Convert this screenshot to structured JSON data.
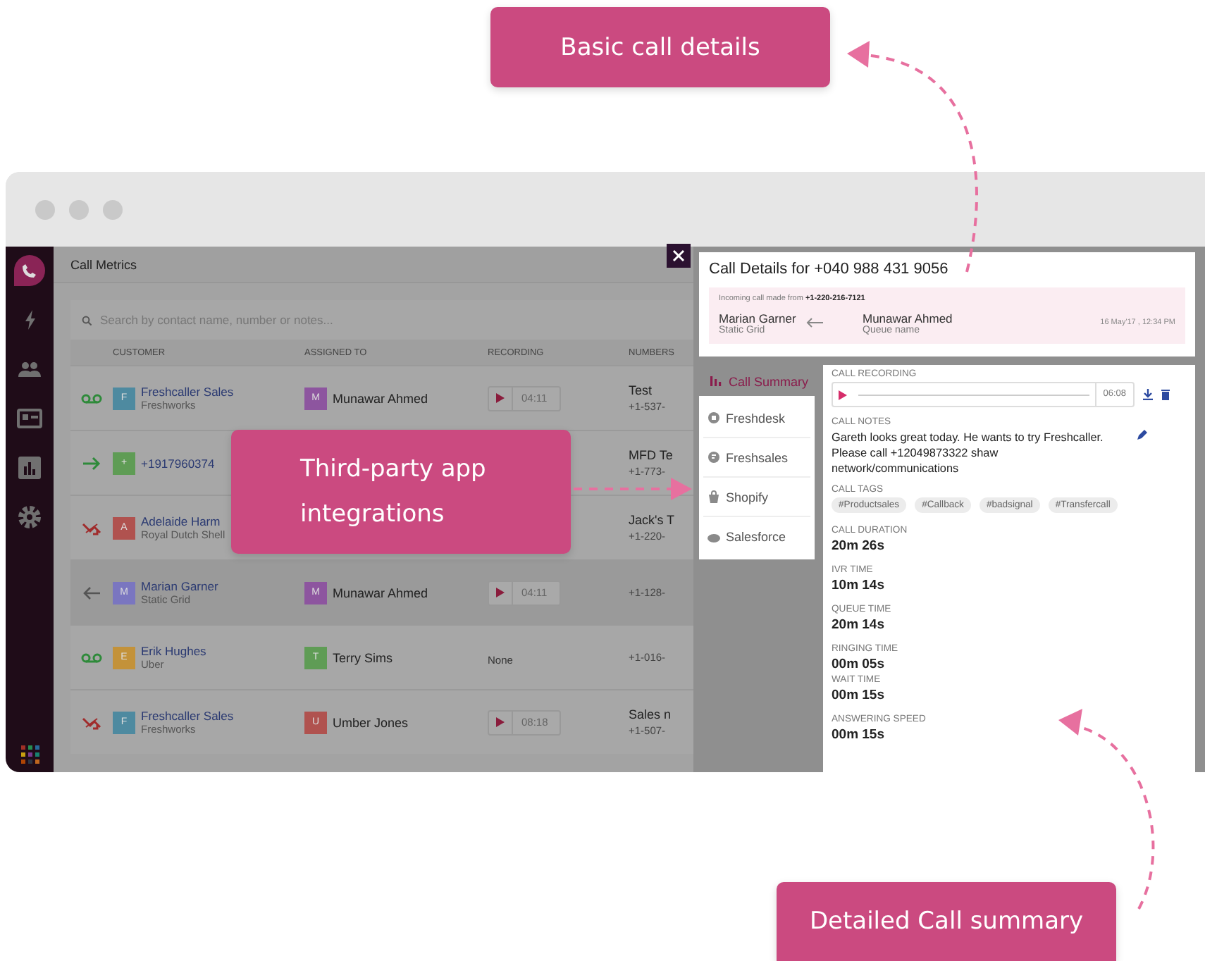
{
  "callouts": [
    {
      "text": "Basic call details"
    },
    {
      "text": "Third-party app integrations"
    },
    {
      "text": "Detailed Call summary"
    }
  ],
  "sidebar": {
    "items": [
      {
        "selected": true
      },
      {
        "selected": false
      },
      {
        "selected": false
      },
      {
        "selected": false
      },
      {
        "selected": false
      },
      {
        "selected": false
      }
    ]
  },
  "page_title": "Call Metrics",
  "search": {
    "placeholder": "Search by contact name, number or notes..."
  },
  "table": {
    "columns": [
      "CUSTOMER",
      "ASSIGNED TO",
      "RECORDING",
      "NUMBERS"
    ],
    "rows": [
      {
        "kind": "voicemail",
        "avatar": "F",
        "color": "#4e8aa0",
        "name": "Freshcaller Sales",
        "company": "Freshworks",
        "assignee": {
          "avatar": "M",
          "color": "#8d559f",
          "name": "Munawar Ahmed"
        },
        "recording": {
          "kind": "player",
          "duration": "04:11"
        },
        "number_label": "Test",
        "number": "+1-537-",
        "selected": false
      },
      {
        "kind": "outgoing",
        "avatar": "+",
        "color": "#5f9c55",
        "name": "+1917960374",
        "number_label": "MFD Te",
        "number": "+1-773-",
        "selected": false
      },
      {
        "kind": "missed",
        "avatar": "A",
        "color": "#b0524f",
        "name": "Adelaide Harm",
        "company": "Royal Dutch Shell",
        "number_label": "Jack's T",
        "number": "+1-220-",
        "selected": false
      },
      {
        "kind": "incoming",
        "avatar": "M",
        "color": "#7a76c0",
        "name": "Marian Garner",
        "company": "Static Grid",
        "assignee": {
          "avatar": "M",
          "color": "#8d559f",
          "name": "Munawar Ahmed"
        },
        "recording": {
          "kind": "player",
          "duration": "04:11"
        },
        "number": "+1-128-",
        "selected": true
      },
      {
        "kind": "voicemail",
        "avatar": "E",
        "color": "#c3923a",
        "name": "Erik Hughes",
        "company": "Uber",
        "assignee": {
          "avatar": "T",
          "color": "#5f9c55",
          "name": "Terry Sims"
        },
        "recording": {
          "kind": "none",
          "text": "None"
        },
        "number": "+1-016-",
        "selected": false
      },
      {
        "kind": "missed",
        "avatar": "F",
        "color": "#4e8aa0",
        "name": "Freshcaller Sales",
        "company": "Freshworks",
        "assignee": {
          "avatar": "U",
          "color": "#b0524f",
          "name": "Umber Jones"
        },
        "recording": {
          "kind": "player",
          "duration": "08:18"
        },
        "number_label": "Sales n",
        "number": "+1-507-",
        "selected": false
      }
    ]
  },
  "details": {
    "title": "Call Details for +040 988 431 9056",
    "direction_label": "Incoming call  made from",
    "from_number": "+1-220-216-7121",
    "caller": {
      "name": "Marian Garner",
      "sub": "Static Grid"
    },
    "agent": {
      "name": "Munawar Ahmed",
      "sub": "Queue name"
    },
    "timestamp": "16 May'17 , 12:34 PM"
  },
  "details_nav": [
    {
      "label": "Call Summary",
      "selected": true
    },
    {
      "label": "Freshdesk",
      "selected": false
    },
    {
      "label": "Freshsales",
      "selected": false
    },
    {
      "label": "Shopify",
      "selected": false
    },
    {
      "label": "Salesforce",
      "selected": false
    }
  ],
  "summary": {
    "recording": {
      "heading": "CALL RECORDING",
      "duration": "06:08"
    },
    "notes": {
      "heading": "CALL NOTES",
      "text": "Gareth looks great today. He wants to try Freshcaller. Please call +12049873322 shaw network/communications"
    },
    "tags": {
      "heading": "CALL TAGS",
      "items": [
        "#Productsales",
        "#Callback",
        "#badsignal",
        "#Transfercall"
      ]
    },
    "metrics": [
      {
        "heading": "CALL DURATION",
        "value": "20m 26s"
      },
      {
        "heading": "IVR TIME",
        "value": "10m 14s"
      },
      {
        "heading": "QUEUE TIME",
        "value": "20m 14s"
      },
      {
        "heading": "RINGING TIME",
        "value": "00m 05s"
      },
      {
        "heading": "WAIT TIME",
        "value": "00m 15s"
      },
      {
        "heading": "ANSWERING SPEED",
        "value": "00m 15s"
      }
    ]
  }
}
